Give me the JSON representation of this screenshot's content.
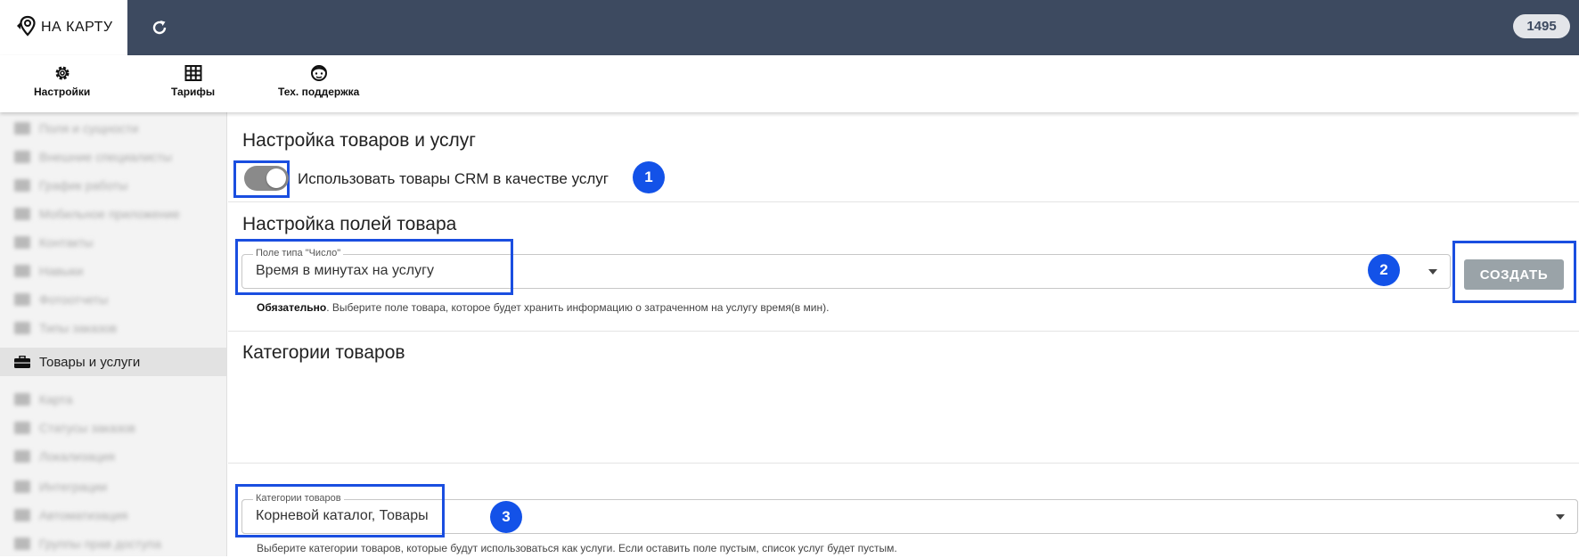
{
  "header": {
    "logo_text": "НА КАРТУ",
    "badge": "1495"
  },
  "toolbar": {
    "items": [
      {
        "label": "Настройки",
        "icon": "gear-icon"
      },
      {
        "label": "Тарифы",
        "icon": "table-icon"
      },
      {
        "label": "Тех. поддержка",
        "icon": "support-icon"
      }
    ]
  },
  "sidebar": {
    "items": [
      {
        "label": "Поля и сущности"
      },
      {
        "label": "Внешние специалисты"
      },
      {
        "label": "График работы"
      },
      {
        "label": "Мобильное приложение"
      },
      {
        "label": "Контакты"
      },
      {
        "label": "Навыки"
      },
      {
        "label": "Фотоотчеты"
      },
      {
        "label": "Типы заказов"
      },
      {
        "label": "Товары и услуги"
      },
      {
        "label": "Карта"
      },
      {
        "label": "Статусы заказов"
      },
      {
        "label": "Локализация"
      },
      {
        "label": "Интеграции"
      },
      {
        "label": "Автоматизация"
      },
      {
        "label": "Группы прав доступа"
      }
    ]
  },
  "services_settings": {
    "title": "Настройка товаров и услуг",
    "toggle_label": "Использовать товары CRM в качестве услуг",
    "marker": "1"
  },
  "product_fields": {
    "title": "Настройка полей товара",
    "field_label": "Поле типа \"Число\"",
    "field_value": "Время в минутах на услугу",
    "marker": "2",
    "create_label": "СОЗДАТЬ",
    "helper_bold": "Обязательно",
    "helper_text": ". Выберите поле товара, которое будет хранить информацию о затраченном на услугу время(в мин)."
  },
  "categories": {
    "title": "Категории товаров",
    "field_label": "Категории товаров",
    "field_value": "Корневой каталог, Товары",
    "marker": "3",
    "helper_text": "Выберите категории товаров, которые будут использоваться как услуги. Если оставить поле пустым, список услуг будет пустым."
  },
  "colors": {
    "header_bg": "#3d4a60",
    "highlight": "#1a4ee0",
    "marker_bg": "#1352e8",
    "button_bg": "#9aa3a8"
  }
}
